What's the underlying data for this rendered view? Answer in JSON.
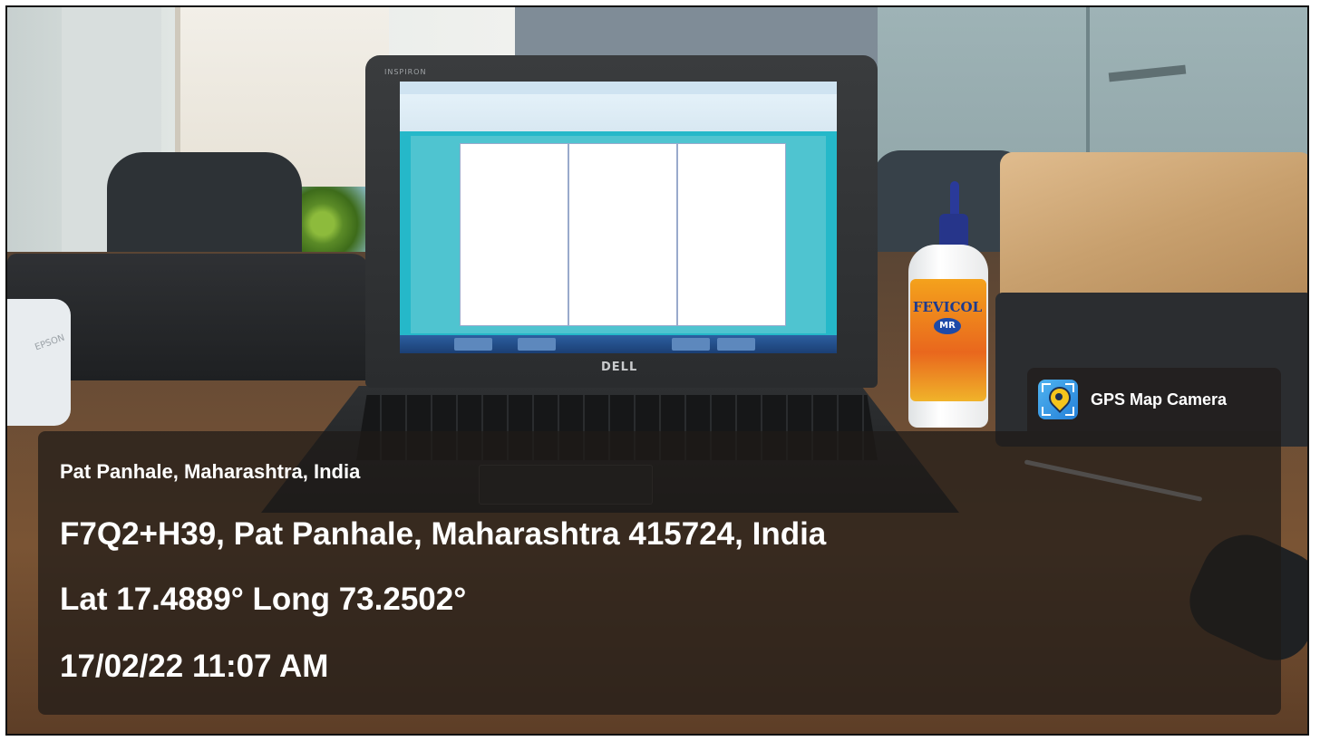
{
  "watermark": {
    "app_name": "GPS Map Camera",
    "icon": "gps-map-camera-icon"
  },
  "location": {
    "place": "Pat Panhale, Maharashtra, India",
    "address": "F7Q2+H39, Pat Panhale, Maharashtra 415724, India",
    "coordinates": "Lat 17.4889° Long 73.2502°",
    "datetime": "17/02/22 11:07 AM"
  },
  "photo": {
    "laptop_brand_top": "INSPIRON",
    "laptop_logo": "DELL",
    "bottle_brand": "FEVICOL",
    "bottle_badge": "MR",
    "printer_label": "EPSON"
  }
}
